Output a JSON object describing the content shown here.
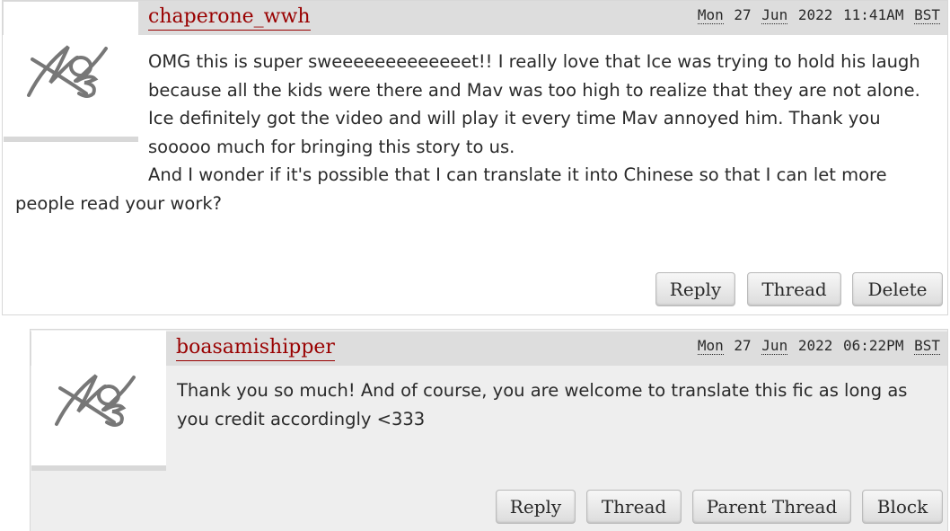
{
  "comments": [
    {
      "username": "chaperone_wwh",
      "date": {
        "day": "Mon",
        "date": "27",
        "month": "Jun",
        "year": "2022",
        "time": "11:41AM",
        "tz": "BST"
      },
      "paragraphs": [
        "OMG this is super sweeeeeeeeeeeeet!! I really love that Ice was trying to hold his laugh because all the kids were there and Mav was too high to realize that they are not alone.",
        "Ice definitely got the video and will play it every time Mav annoyed him. Thank you sooooo much for bringing this story to us.",
        "And I wonder if it's possible that I can translate it into Chinese so that I can let more people read your work?"
      ],
      "actions": {
        "reply": "Reply",
        "thread": "Thread",
        "delete": "Delete"
      },
      "icon": "default-user-icon"
    },
    {
      "username": "boasamishipper",
      "date": {
        "day": "Mon",
        "date": "27",
        "month": "Jun",
        "year": "2022",
        "time": "06:22PM",
        "tz": "BST"
      },
      "paragraphs": [
        "Thank you so much! And of course, you are welcome to translate this fic as long as you credit accordingly <333"
      ],
      "actions": {
        "reply": "Reply",
        "thread": "Thread",
        "parent_thread": "Parent Thread",
        "block": "Block"
      },
      "icon": "default-user-icon"
    }
  ]
}
